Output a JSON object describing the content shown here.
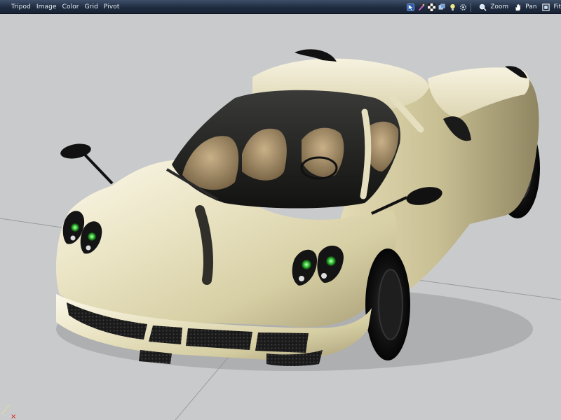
{
  "menu": {
    "items": [
      "Tripod",
      "Image",
      "Color",
      "Grid",
      "Pivot"
    ]
  },
  "toolbar": {
    "icons": [
      "cursor-icon",
      "brush-icon",
      "checker-icon",
      "layers-icon",
      "light-icon",
      "settings-icon"
    ],
    "zoom_label": "Zoom",
    "pan_label": "Pan",
    "fit_label": "Fit"
  },
  "axis": {
    "x_label": "×"
  },
  "colors": {
    "menubar": "#1f2c40",
    "viewport_bg": "#c9cacb",
    "car_body": "#e8e2c0",
    "headlight_glow": "#3fcf3f",
    "axis_x": "#e02020"
  }
}
